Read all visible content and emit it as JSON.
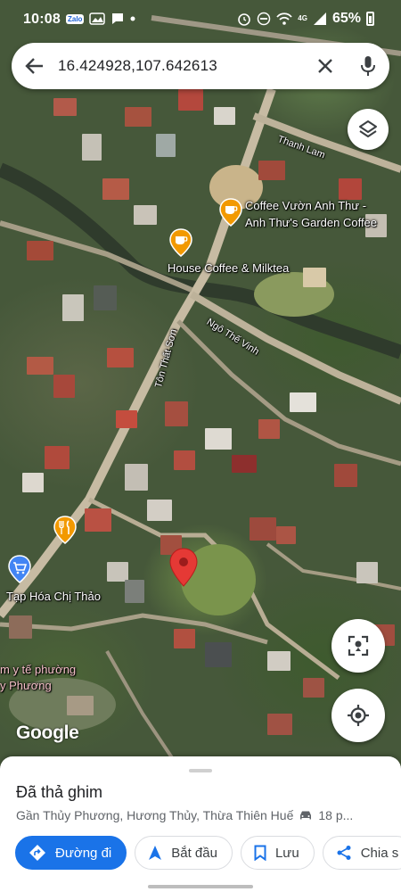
{
  "status_bar": {
    "time": "10:08",
    "app_badge": "Zalo",
    "network": "4G",
    "battery": "65%"
  },
  "search": {
    "query": "16.424928,107.642613"
  },
  "map": {
    "labels": {
      "thanh_lam": "Thanh Lam",
      "coffee_vuon_line1": "Coffee Vườn Anh Thư -",
      "coffee_vuon_line2": "Anh Thư's Garden Coffee",
      "house_coffee": "House Coffee & Milktea",
      "ngo_the_vinh": "Ngô Thế Vinh",
      "ton_that_son": "Tôn Thất Sơn",
      "tap_hoa": "Tạp Hóa Chị Thảo",
      "y_te_line1": "m y tế phường",
      "y_te_line2": "y Phương",
      "google": "Google"
    },
    "icons": {
      "layers": "layers-icon",
      "street_view": "street-view-icon",
      "my_location": "my-location-icon",
      "pin": "red-map-pin",
      "cafe": "cafe-icon",
      "restaurant": "restaurant-icon",
      "shop": "shopping-icon"
    },
    "colors": {
      "pin": "#e53935",
      "cafe_poi": "#f29900",
      "shop_poi": "#4285f4"
    }
  },
  "place_sheet": {
    "title": "Đã thả ghim",
    "subtitle": "Gần Thủy Phương, Hương Thủy, Thừa Thiên Huế",
    "travel_time": "18 p...",
    "actions": {
      "directions": "Đường đi",
      "start": "Bắt đầu",
      "save": "Lưu",
      "share": "Chia s"
    }
  },
  "accent_color": "#1a73e8"
}
